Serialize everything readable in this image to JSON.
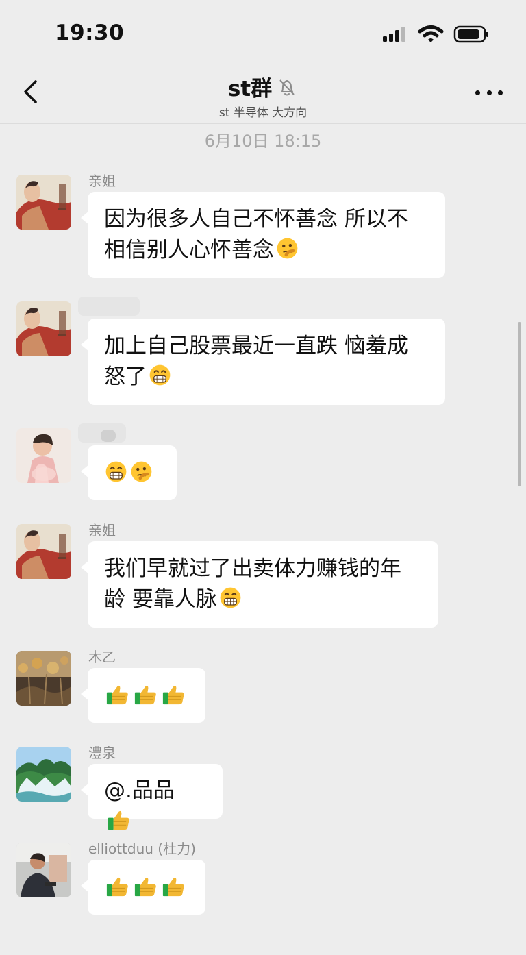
{
  "status_bar": {
    "time": "19:30"
  },
  "chat": {
    "title": "st群",
    "subtitle": "st 半导体 大方向"
  },
  "timestamp": "6月10日 18:15",
  "messages": [
    {
      "sender": "亲姐",
      "text": "因为很多人自己不怀善念 所以不相信别人心怀善念",
      "emojis": [
        "thinking-face"
      ]
    },
    {
      "sender": "",
      "text": "加上自己股票最近一直跌 恼羞成怒了",
      "emojis": [
        "grin-face"
      ]
    },
    {
      "sender": "",
      "text": "",
      "emojis": [
        "grin-face",
        "thinking-face"
      ]
    },
    {
      "sender": "亲姐",
      "text": "我们早就过了出卖体力赚钱的年龄 要靠人脉",
      "emojis": [
        "grin-face"
      ]
    },
    {
      "sender": "木乙",
      "text": "",
      "emojis": [
        "thumbs-up",
        "thumbs-up",
        "thumbs-up"
      ]
    },
    {
      "sender": "澧泉",
      "text": "@.品品 ",
      "emojis": [
        "thumbs-up"
      ]
    },
    {
      "sender": "elliottduu (杜力)",
      "text": "",
      "emojis": [
        "thumbs-up",
        "thumbs-up",
        "thumbs-up"
      ]
    }
  ],
  "colors": {
    "background": "#ededed",
    "bubble": "#ffffff",
    "muted_text": "#8a8a8a"
  }
}
